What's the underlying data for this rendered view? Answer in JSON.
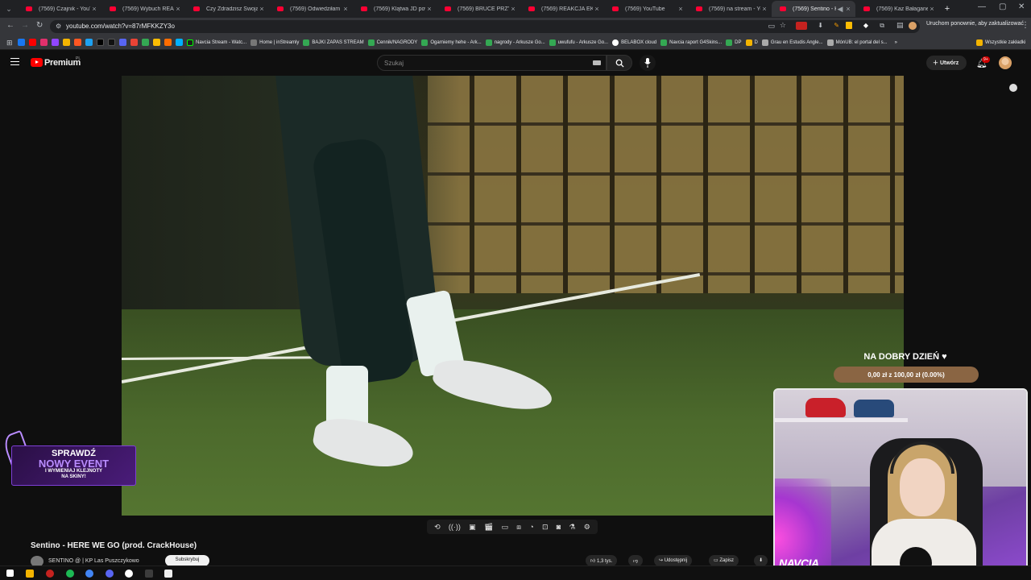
{
  "browser": {
    "tabs": [
      {
        "label": "(7569) Czajnik - YouTube",
        "active": false
      },
      {
        "label": "(7569) Wybuch REAKTOR",
        "active": false
      },
      {
        "label": "Czy Zdradzisz Swoją Ex",
        "active": false
      },
      {
        "label": "(7569) Odwiedziłam Pier",
        "active": false
      },
      {
        "label": "(7569) Klątwa JD powrac",
        "active": false
      },
      {
        "label": "(7569) BRUCE PRZYŁAPAŁ",
        "active": false
      },
      {
        "label": "(7569) REAKCJA EKIPY N",
        "active": false
      },
      {
        "label": "(7569) YouTube",
        "active": false
      },
      {
        "label": "(7569) na stream - YouTu",
        "active": false
      },
      {
        "label": "(7569) Sentino - HERE",
        "active": true
      },
      {
        "label": "(7569) Kaz Bałagane feat",
        "active": false
      }
    ],
    "new_tab": "+",
    "url": "youtube.com/watch?v=87rMFKKZY3o",
    "restart_label": "Uruchom ponownie, aby zaktualizować",
    "bookmarks": [
      "Navcia Stream - Watc...",
      "Home | inStreamly",
      "BAJKI ZAPAS STREAM",
      "Cennik/NAGRODY",
      "Ogarniemy hehe - Ark...",
      "nagrody - Arkusze Go...",
      "uwufufu - Arkusze Go...",
      "BELABOX cloud",
      "Navcia raport G4Skins...",
      "DP",
      "D",
      "Grau en Estudis Angle...",
      "MónUB: el portal del s..."
    ],
    "bookmarks_more": "»",
    "all_bookmarks": "Wszystkie zakładki"
  },
  "youtube": {
    "logo_text": "Premium",
    "region": "PL",
    "search_placeholder": "Szukaj",
    "create_label": "Utwórz",
    "notification_count": "9+",
    "video_title": "Sentino - HERE WE GO (prod. CrackHouse)",
    "channel_name": "SENTINO @ | KP Las Puszczykowo",
    "subscribe_label": "Subskrybuj",
    "likes": "1,3 tys.",
    "share_label": "Udostępnij",
    "save_label": "Zapisz"
  },
  "overlays": {
    "event": {
      "line1": "SPRAWDŹ",
      "line2": "NOWY EVENT",
      "line3a": "I WYMIENIAJ KLEJNOTY",
      "line3b": "NA SKINY!"
    },
    "donation_title": "NA DOBRY DZIEŃ ♥",
    "donation_amount": "0,00 zł z 100,00 zł (0.00%)",
    "donation_progress": 0.0,
    "streamer_tag": "NAVCIA"
  },
  "colors": {
    "youtube_red": "#ff0000",
    "event_purple": "#7e3fd6",
    "donation_bar": "#8a6543"
  }
}
